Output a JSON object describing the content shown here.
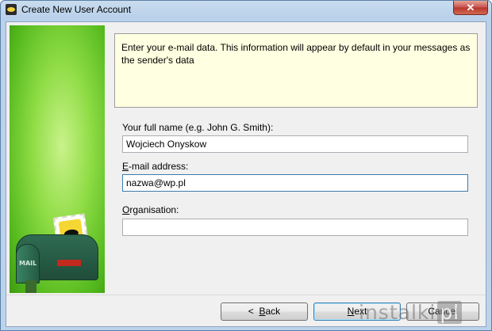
{
  "window": {
    "title": "Create New User Account",
    "close_symbol": "✕"
  },
  "info": {
    "text": "Enter your e-mail data. This information will appear by default in your messages as the sender's data"
  },
  "form": {
    "full_name": {
      "label": "Your full name (e.g. John G. Smith):",
      "value": "Wojciech Onyskow"
    },
    "email": {
      "label_accel": "E",
      "label_rest": "-mail address:",
      "value": "nazwa@wp.pl"
    },
    "organisation": {
      "label_accel": "O",
      "label_rest": "rganisation:",
      "value": ""
    }
  },
  "buttons": {
    "back_prefix": "<  ",
    "back_accel": "B",
    "back_rest": "ack",
    "next_accel": "N",
    "next_rest": "ext",
    "cancel": "Cancel"
  },
  "watermark": {
    "text": "instalki",
    "box": "pl"
  },
  "sidebar": {
    "mailbox_text": "MAIL"
  }
}
